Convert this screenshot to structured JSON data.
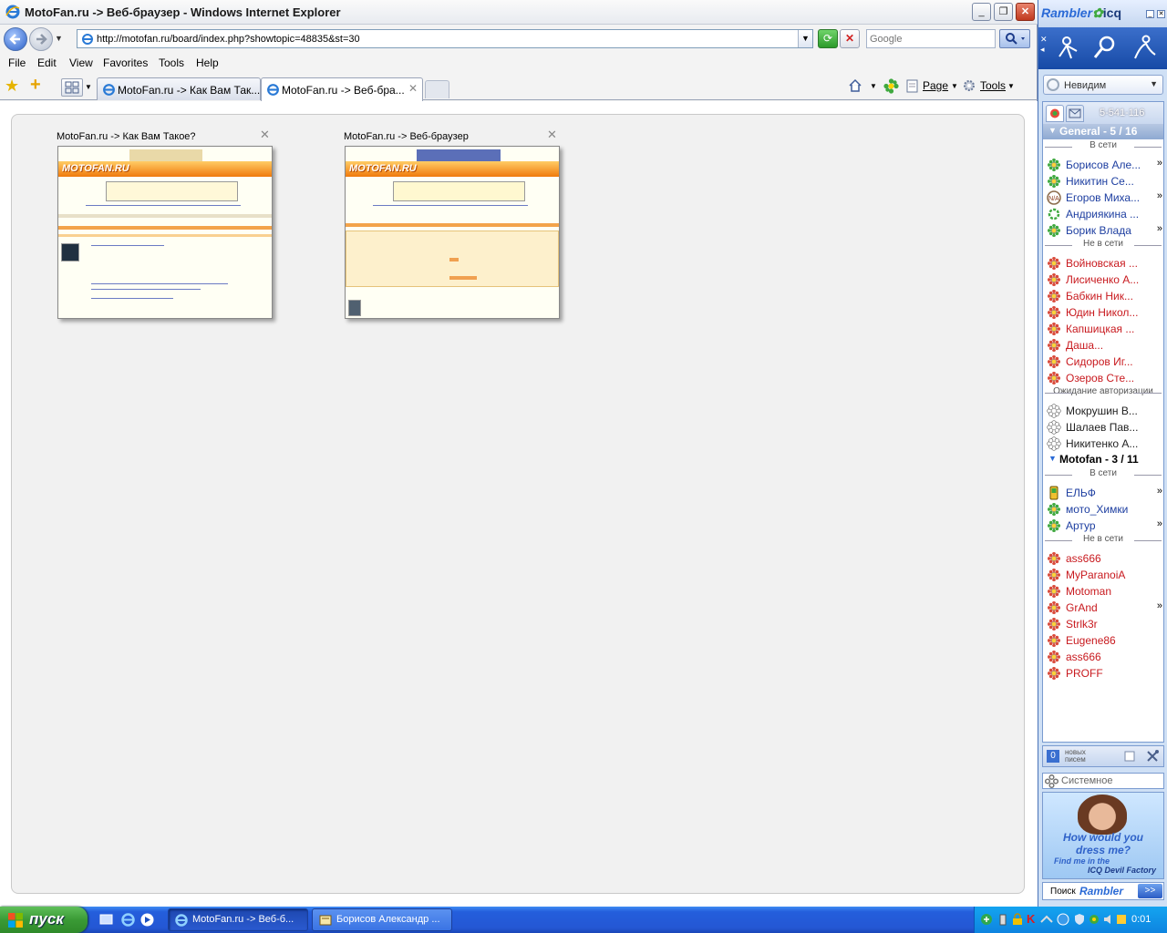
{
  "ie": {
    "title": "MotoFan.ru -> Веб-браузер - Windows Internet Explorer",
    "address": "http://motofan.ru/board/index.php?showtopic=48835&st=30",
    "search_placeholder": "Google",
    "menu": [
      "File",
      "Edit",
      "View",
      "Favorites",
      "Tools",
      "Help"
    ],
    "tabs": [
      {
        "label": "MotoFan.ru -> Как Вам Так...",
        "active": false
      },
      {
        "label": "MotoFan.ru -> Веб-бра...",
        "active": true
      }
    ],
    "commands": {
      "page": "Page",
      "tools": "Tools"
    },
    "quick_tabs": [
      {
        "title": "MotoFan.ru -> Как Вам Такое?",
        "logo": "MOTOFAN.RU"
      },
      {
        "title": "MotoFan.ru -> Веб-браузер",
        "logo": "MOTOFAN.RU"
      }
    ]
  },
  "icq": {
    "brand": "Rambler",
    "brand_suffix": "icq",
    "status": "Невидим",
    "uin": "5-541-116",
    "groups": [
      {
        "name": "General  -  5 / 16",
        "sections": [
          {
            "label": "В сети",
            "state": "online",
            "contacts": [
              {
                "name": "Борисов Але...",
                "more": true
              },
              {
                "name": "Никитин Се...",
                "more": false
              },
              {
                "name": "Егоров Миха...",
                "more": true,
                "icon": "na"
              },
              {
                "name": "Андриякина ...",
                "more": false,
                "icon": "ring"
              },
              {
                "name": "Борик Влада",
                "more": true
              }
            ]
          },
          {
            "label": "Не в сети",
            "state": "offline",
            "contacts": [
              {
                "name": "Войновская ..."
              },
              {
                "name": "Лисиченко А..."
              },
              {
                "name": "Бабкин Ник..."
              },
              {
                "name": "Юдин Никол..."
              },
              {
                "name": "Капшицкая ..."
              },
              {
                "name": "Даша..."
              },
              {
                "name": "Сидоров Иг..."
              },
              {
                "name": "Озеров Сте..."
              }
            ]
          },
          {
            "label": "Ожидание авторизации",
            "state": "auth",
            "contacts": [
              {
                "name": "Мокрушин В..."
              },
              {
                "name": "Шалаев Пав..."
              },
              {
                "name": "Никитенко А..."
              }
            ]
          }
        ]
      },
      {
        "name": "Motofan  -  3 / 11",
        "sections": [
          {
            "label": "В сети",
            "state": "online",
            "contacts": [
              {
                "name": "ЕЛЬФ",
                "more": true,
                "icon": "mobile"
              },
              {
                "name": "мото_Химки",
                "more": false
              },
              {
                "name": "Артур",
                "more": true
              }
            ]
          },
          {
            "label": "Не в сети",
            "state": "offline",
            "contacts": [
              {
                "name": "ass666"
              },
              {
                "name": "MyParanoiA"
              },
              {
                "name": "Motoman"
              },
              {
                "name": "GrAnd",
                "more": true
              },
              {
                "name": "Strlk3r"
              },
              {
                "name": "Eugene86"
              },
              {
                "name": "ass666"
              },
              {
                "name": "PROFF"
              }
            ]
          }
        ]
      }
    ],
    "mail": {
      "count": "0",
      "label": "новых писем"
    },
    "system_label": "Системное",
    "ad": {
      "line1": "How would you",
      "line2": "dress me?",
      "line3": "Find me in the",
      "line4": "ICQ Devil Factory"
    },
    "search": {
      "label": "Поиск",
      "brand": "Rambler",
      "go": ">>"
    }
  },
  "taskbar": {
    "start": "пуск",
    "tasks": [
      {
        "label": "MotoFan.ru -> Веб-б...",
        "active": true
      },
      {
        "label": "Борисов Александр ...",
        "active": false
      }
    ],
    "clock": "0:01"
  },
  "colors": {
    "online": "#1d3ea0",
    "offline": "#c8191e",
    "accent": "#245edc"
  }
}
